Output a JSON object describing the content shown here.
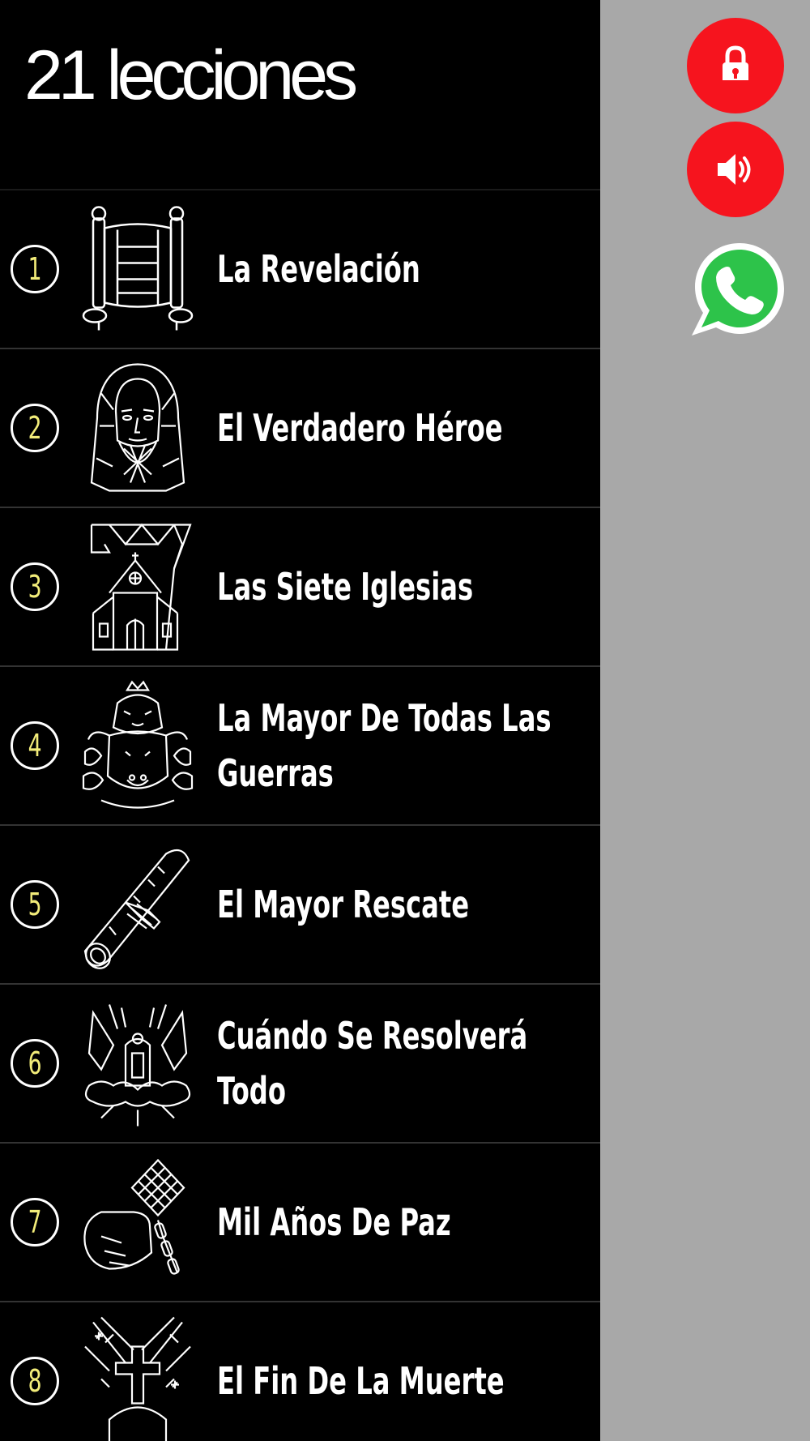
{
  "header": {
    "title": "21 lecciones"
  },
  "lessons": [
    {
      "number": "1",
      "title": "La Revelación",
      "icon": "scroll-icon"
    },
    {
      "number": "2",
      "title": "El Verdadero Héroe",
      "icon": "jesus-face-icon"
    },
    {
      "number": "3",
      "title": "Las Siete Iglesias",
      "icon": "church-seven-icon"
    },
    {
      "number": "4",
      "title": "La Mayor De Todas Las Guerras",
      "icon": "beasts-icon"
    },
    {
      "number": "5",
      "title": "El Mayor Rescate",
      "icon": "rolled-scroll-icon"
    },
    {
      "number": "6",
      "title": "Cuándo Se Resolverá Todo",
      "icon": "throne-angels-icon"
    },
    {
      "number": "7",
      "title": "Mil Años De Paz",
      "icon": "hand-chain-icon"
    },
    {
      "number": "8",
      "title": "El Fin De La Muerte",
      "icon": "cross-tomb-icon"
    }
  ],
  "side_buttons": {
    "lock": "lock-icon",
    "sound": "speaker-icon",
    "whatsapp": "whatsapp-icon"
  },
  "colors": {
    "background": "#000000",
    "sidebar": "#a8a8a8",
    "accent_red": "#f6141e",
    "number_yellow": "#f2ec79",
    "whatsapp_green": "#2dc34a"
  }
}
